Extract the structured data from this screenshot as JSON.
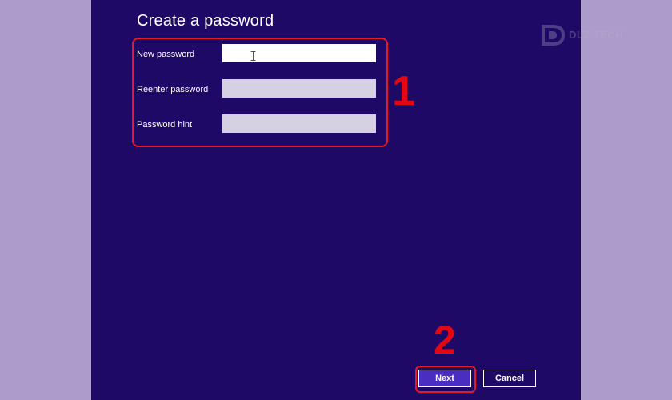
{
  "dialog": {
    "title": "Create a password",
    "fields": [
      {
        "label": "New password",
        "value": "",
        "placeholder": ""
      },
      {
        "label": "Reenter password",
        "value": "",
        "placeholder": ""
      },
      {
        "label": "Password hint",
        "value": "",
        "placeholder": ""
      }
    ],
    "buttons": {
      "next_label": "Next",
      "cancel_label": "Cancel"
    }
  },
  "annotations": {
    "step_1": "1",
    "step_2": "2"
  },
  "watermark": {
    "text": "DLZ TECH"
  },
  "colors": {
    "dialog_background": "#1e0a66",
    "page_background": "#ad9bcb",
    "annotation_red": "#e30613",
    "next_button": "#4a2ec2"
  },
  "icons": {
    "cursor": "text-cursor-icon",
    "logo": "dlz-tech-logo-icon"
  }
}
